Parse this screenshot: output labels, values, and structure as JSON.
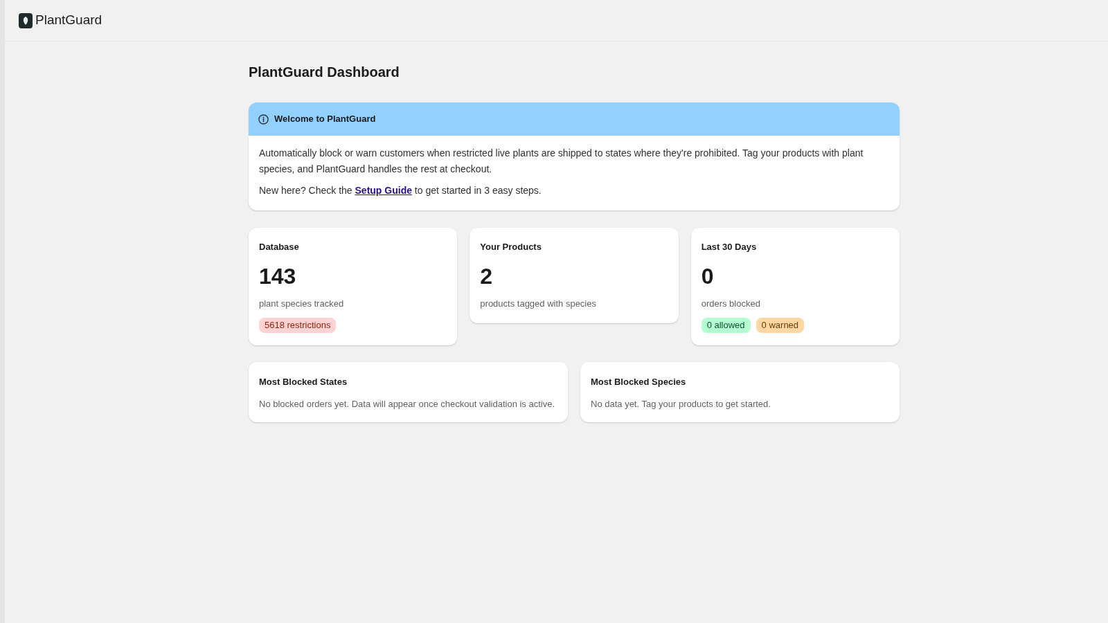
{
  "header": {
    "app_name": "PlantGuard"
  },
  "page": {
    "title": "PlantGuard Dashboard"
  },
  "banner": {
    "title": "Welcome to PlantGuard",
    "paragraphs": [
      {
        "text": "Automatically block or warn customers when restricted live plants are shipped to states where they're prohibited. Tag your products with plant species, and PlantGuard handles the rest at checkout."
      },
      {
        "text": "New here? Check the ",
        "link": "Setup Guide",
        "text_after": " to get started in 3 easy steps."
      }
    ]
  },
  "stat_cards": [
    {
      "title": "Database",
      "value": "143",
      "caption": "plant species tracked",
      "badges": [
        {
          "label": "5618 restrictions",
          "kind": "critical"
        }
      ]
    },
    {
      "title": "Your Products",
      "value": "2",
      "caption": "products tagged with species"
    },
    {
      "title": "Last 30 Days",
      "value": "0",
      "caption": "orders blocked",
      "badges": [
        {
          "label": "0 allowed",
          "kind": "success"
        },
        {
          "label": "0 warned",
          "kind": "warning"
        }
      ]
    }
  ],
  "info_cards": [
    {
      "title": "Most Blocked States",
      "text": "No blocked orders yet. Data will appear once checkout validation is active."
    },
    {
      "title": "Most Blocked Species",
      "text": "No data yet. Tag your products to get started."
    }
  ]
}
